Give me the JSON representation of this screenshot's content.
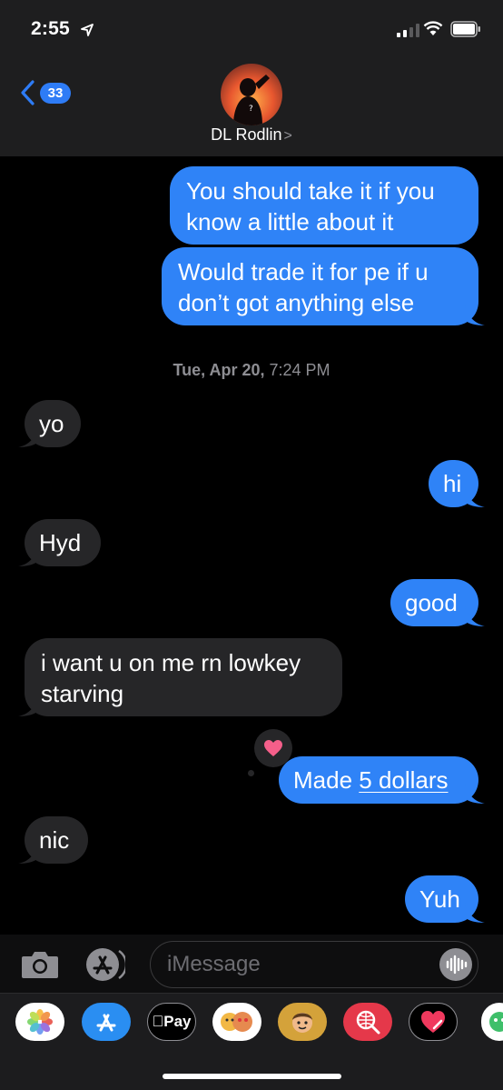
{
  "status_bar": {
    "time": "2:55"
  },
  "header": {
    "back_badge": "33",
    "contact_name": "DL Rodlin",
    "contact_chevron": ">"
  },
  "thread": {
    "messages": [
      {
        "direction": "outgoing",
        "text": "You should take it if you know a little about it"
      },
      {
        "direction": "outgoing",
        "text": "Would trade it for pe if u don’t got anything else"
      },
      {
        "direction": "incoming",
        "text": "yo"
      },
      {
        "direction": "outgoing",
        "text": "hi"
      },
      {
        "direction": "incoming",
        "text": "Hyd"
      },
      {
        "direction": "outgoing",
        "text": "good"
      },
      {
        "direction": "incoming",
        "text": "i want u on me rn lowkey starving"
      },
      {
        "direction": "outgoing",
        "text_before_link": "Made ",
        "link_text": "5 dollars",
        "tapback": "heart"
      },
      {
        "direction": "incoming",
        "text": "nic"
      },
      {
        "direction": "outgoing",
        "text": "Yuh"
      }
    ],
    "timestamp": {
      "date": "Tue, Apr 20,",
      "time": "7:24 PM"
    }
  },
  "input": {
    "placeholder": "iMessage"
  },
  "app_drawer": {
    "apps": [
      "photos-icon",
      "app-store-icon",
      "apple-pay-icon",
      "memoji-stickers-icon",
      "memoji-icon",
      "web-search-icon",
      "digital-touch-icon",
      "more-apps-icon"
    ],
    "apple_pay_label": "Pay"
  },
  "colors": {
    "outgoing": "#2f83f7",
    "incoming": "#262628",
    "accent": "#2e7cf6"
  }
}
